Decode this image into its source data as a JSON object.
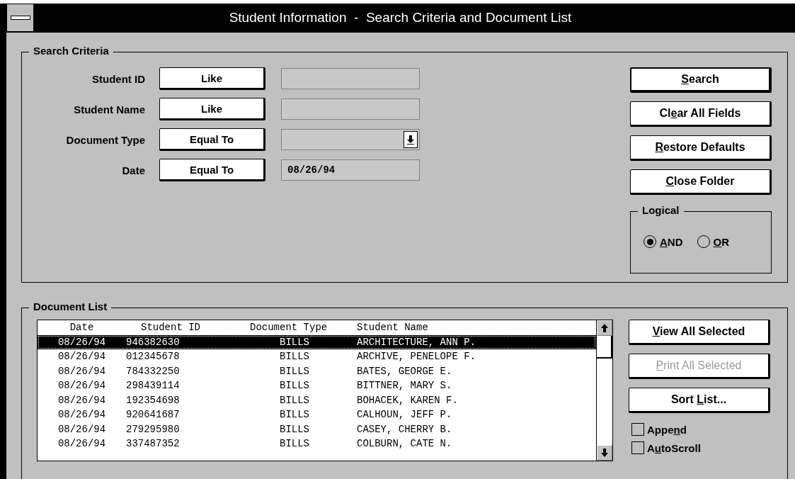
{
  "window": {
    "title": "Student Information  -  Search Criteria and Document List"
  },
  "search_criteria": {
    "title": "Search Criteria",
    "fields": [
      {
        "kind": "text",
        "label": "Student ID",
        "operator": "Like"
      },
      {
        "kind": "text",
        "label": "Student Name",
        "operator": "Like"
      },
      {
        "kind": "dropdown",
        "label": "Document Type",
        "operator": "Equal To"
      },
      {
        "kind": "text",
        "label": "Date",
        "operator": "Equal To",
        "value": "08/26/94"
      }
    ],
    "buttons": [
      {
        "key": "S",
        "after": "earch",
        "default": true,
        "disabled": false
      },
      {
        "before": "Cl",
        "key": "e",
        "after": "ar All Fields",
        "default": false,
        "disabled": false
      },
      {
        "key": "R",
        "after": "estore Defaults",
        "default": false,
        "disabled": false
      },
      {
        "key": "C",
        "after": "lose Folder",
        "default": false,
        "disabled": false
      }
    ],
    "logical": {
      "title": "Logical",
      "options": [
        {
          "key": "A",
          "after": "ND",
          "selected": true
        },
        {
          "key": "O",
          "after": "R",
          "selected": false
        }
      ]
    }
  },
  "document_list": {
    "title": "Document List",
    "columns": [
      "Date",
      "Student ID",
      "Document Type",
      "Student Name"
    ],
    "rows": [
      {
        "cells": [
          "08/26/94",
          "946382630",
          "BILLS",
          "ARCHITECTURE, ANN P."
        ],
        "selected": true
      },
      {
        "cells": [
          "08/26/94",
          "012345678",
          "BILLS",
          "ARCHIVE, PENELOPE F."
        ],
        "selected": false
      },
      {
        "cells": [
          "08/26/94",
          "784332250",
          "BILLS",
          "BATES, GEORGE E."
        ],
        "selected": false
      },
      {
        "cells": [
          "08/26/94",
          "298439114",
          "BILLS",
          "BITTNER, MARY S."
        ],
        "selected": false
      },
      {
        "cells": [
          "08/26/94",
          "192354698",
          "BILLS",
          "BOHACEK, KAREN F."
        ],
        "selected": false
      },
      {
        "cells": [
          "08/26/94",
          "920641687",
          "BILLS",
          "CALHOUN, JEFF P."
        ],
        "selected": false
      },
      {
        "cells": [
          "08/26/94",
          "279295980",
          "BILLS",
          "CASEY, CHERRY B."
        ],
        "selected": false
      },
      {
        "cells": [
          "08/26/94",
          "337487352",
          "BILLS",
          "COLBURN, CATE N."
        ],
        "selected": false
      }
    ],
    "buttons": [
      {
        "key": "V",
        "after": "iew All Selected",
        "default": false,
        "disabled": false
      },
      {
        "key": "P",
        "after": "rint All Selected",
        "default": false,
        "disabled": true
      },
      {
        "before": "Sort ",
        "key": "L",
        "after": "ist...",
        "default": false,
        "disabled": false
      }
    ],
    "checkboxes": [
      {
        "before": "Appe",
        "key": "n",
        "after": "d",
        "checked": false
      },
      {
        "before": "A",
        "key": "u",
        "after": "toScroll",
        "checked": false
      }
    ]
  }
}
